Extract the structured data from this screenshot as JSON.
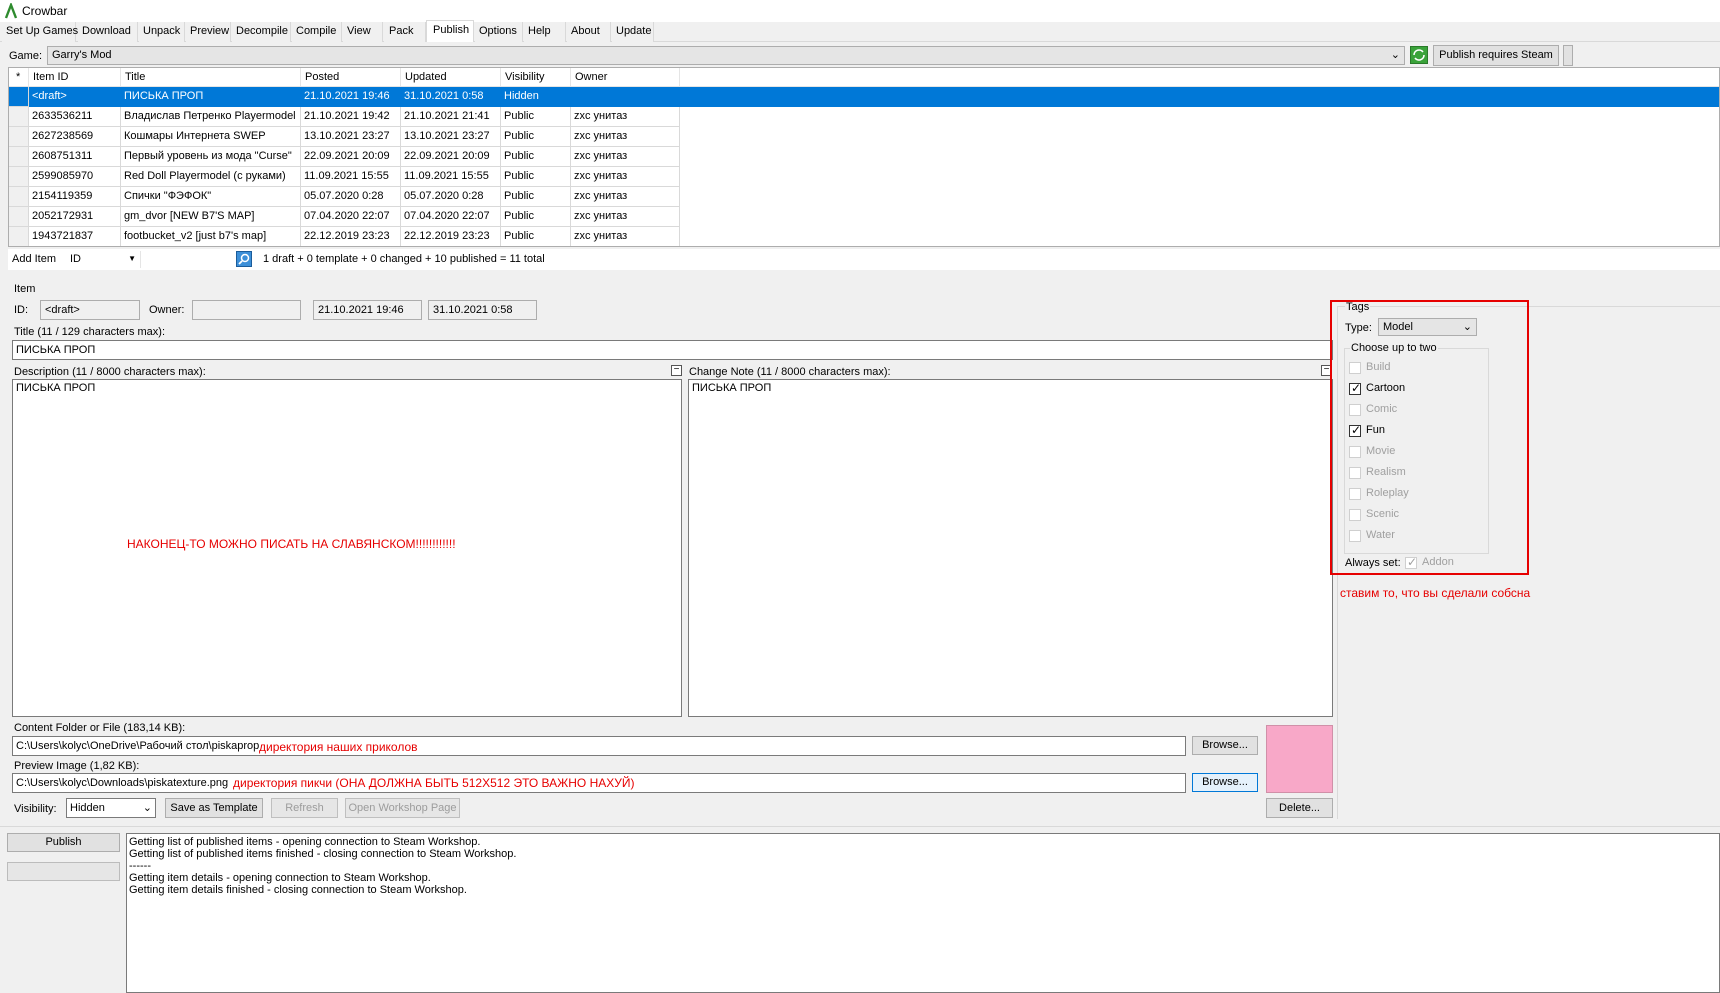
{
  "app": {
    "title": "Crowbar"
  },
  "tabs": [
    "Set Up Games",
    "Download",
    "Unpack",
    "Preview",
    "Decompile",
    "Compile",
    "View",
    "Pack",
    "Publish",
    "Options",
    "Help",
    "About",
    "Update"
  ],
  "active_tab": "Publish",
  "game": {
    "label": "Game:",
    "value": "Garry's Mod",
    "publish_button": "Publish requires Steam"
  },
  "table": {
    "columns": [
      "*",
      "Item ID",
      "Title",
      "Posted",
      "Updated",
      "Visibility",
      "Owner"
    ],
    "rows": [
      [
        "",
        "<draft>",
        "ПИСЬКА ПРОП",
        "21.10.2021 19:46",
        "31.10.2021 0:58",
        "Hidden",
        ""
      ],
      [
        "",
        "2633536211",
        "Владислав Петренко Playermodel",
        "21.10.2021 19:42",
        "21.10.2021 21:41",
        "Public",
        "zxc унитаз"
      ],
      [
        "",
        "2627238569",
        "Кошмары Интернета SWEP",
        "13.10.2021 23:27",
        "13.10.2021 23:27",
        "Public",
        "zxc унитаз"
      ],
      [
        "",
        "2608751311",
        "Первый уровень из мода \"Curse\"",
        "22.09.2021 20:09",
        "22.09.2021 20:09",
        "Public",
        "zxc унитаз"
      ],
      [
        "",
        "2599085970",
        "Red Doll Playermodel (с руками)",
        "11.09.2021 15:55",
        "11.09.2021 15:55",
        "Public",
        "zxc унитаз"
      ],
      [
        "",
        "2154119359",
        "Спички \"ФЭФОК\"",
        "05.07.2020 0:28",
        "05.07.2020 0:28",
        "Public",
        "zxc унитаз"
      ],
      [
        "",
        "2052172931",
        "gm_dvor [NEW B7'S MAP]",
        "07.04.2020 22:07",
        "07.04.2020 22:07",
        "Public",
        "zxc унитаз"
      ],
      [
        "",
        "1943721837",
        "footbucket_v2 [just b7's map]",
        "22.12.2019 23:23",
        "22.12.2019 23:23",
        "Public",
        "zxc унитаз"
      ]
    ]
  },
  "add_item": {
    "label": "Add Item",
    "search_type": "ID",
    "summary": "1 draft + 0 template + 0 changed + 10 published = 11 total"
  },
  "item": {
    "group_label": "Item",
    "id_label": "ID:",
    "id_value": "<draft>",
    "owner_label": "Owner:",
    "owner_value": "",
    "posted": "21.10.2021 19:46",
    "updated": "31.10.2021 0:58",
    "title_label": "Title (11 / 129 characters max):",
    "title_value": "ПИСЬКА ПРОП",
    "desc_label": "Description (11 / 8000 characters max):",
    "desc_value": "ПИСЬКА ПРОП",
    "change_label": "Change Note (11 / 8000 characters max):",
    "change_value": "ПИСЬКА ПРОП",
    "content_label": "Content Folder or File (183,14 KB):",
    "content_value": "C:\\Users\\kolyc\\OneDrive\\Рабочий стол\\piskaprop",
    "preview_label": "Preview Image (1,82 KB):",
    "preview_value": "C:\\Users\\kolyc\\Downloads\\piskatexture.png",
    "browse": "Browse...",
    "visibility_label": "Visibility:",
    "visibility_value": "Hidden",
    "save_template": "Save as Template",
    "refresh": "Refresh",
    "open_workshop": "Open Workshop Page",
    "delete": "Delete...",
    "preview_color": "#f8a8c8"
  },
  "tags": {
    "label": "Tags",
    "type_label": "Type:",
    "type_value": "Model",
    "choose_label": "Choose up to two",
    "items": [
      {
        "name": "Build",
        "checked": false
      },
      {
        "name": "Cartoon",
        "checked": true
      },
      {
        "name": "Comic",
        "checked": false
      },
      {
        "name": "Fun",
        "checked": true
      },
      {
        "name": "Movie",
        "checked": false
      },
      {
        "name": "Realism",
        "checked": false
      },
      {
        "name": "Roleplay",
        "checked": false
      },
      {
        "name": "Scenic",
        "checked": false
      },
      {
        "name": "Water",
        "checked": false
      }
    ],
    "always_label": "Always set:",
    "always_value": "Addon"
  },
  "annotations": {
    "slavic": "НАКОНЕЦ-ТО МОЖНО ПИСАТЬ НА СЛАВЯНСКОМ!!!!!!!!!!!!",
    "content_dir": "директория наших приколов",
    "preview_dir": "директория пикчи (ОНА ДОЛЖНА БЫТЬ 512X512 ЭТО ВАЖНО НАХУЙ)",
    "tags": "ставим то, что вы сделали собсна",
    "color": "#e60000"
  },
  "bottom": {
    "publish": "Publish",
    "log": [
      "Getting list of published items - opening connection to Steam Workshop.",
      "Getting list of published items finished - closing connection to Steam Workshop.",
      "------",
      "Getting item details - opening connection to Steam Workshop.",
      "Getting item details finished - closing connection to Steam Workshop."
    ]
  }
}
